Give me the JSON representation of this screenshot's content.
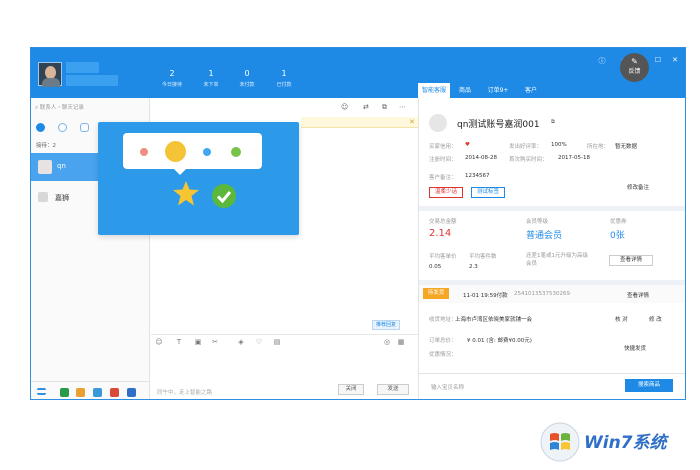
{
  "stats": [
    {
      "num": "2",
      "label": "今日接待"
    },
    {
      "num": "1",
      "label": "未下单"
    },
    {
      "num": "0",
      "label": "未付款"
    },
    {
      "num": "1",
      "label": "已付款"
    }
  ],
  "right_tabs": [
    "智能客服",
    "商品",
    "订单9+",
    "客户"
  ],
  "left_panel": {
    "search_placeholder": "联系人・聊天记录",
    "queue_label": "接待：2",
    "contacts": [
      {
        "name": "qn",
        "selected": true
      },
      {
        "name": "嘉狮",
        "selected": false
      }
    ]
  },
  "chat": {
    "recommend_label": "推荐回复",
    "input_hint": "同午中，走上智能之路",
    "close_btn": "关闭",
    "send_btn": "发送"
  },
  "customer": {
    "account": "qn测试账号嘉润001",
    "credit_label": "买家信用：",
    "credit_value": "♥",
    "good_rate_label": "发出好评率：",
    "good_rate_value": "100%",
    "location_label": "所在地：",
    "location_value": "暂无数据",
    "reg_label": "注册时间：",
    "reg_value": "2014-08-28",
    "last_buy_label": "首次购买时间：",
    "last_buy_value": "2017-05-18",
    "remark_label": "客户备注：",
    "remark_value": "1234567",
    "tag1": "温柔少话",
    "tag2": "测试标签",
    "modify_remark_btn": "修改备注"
  },
  "trade": {
    "total_label": "交易总金额",
    "total_value": "2.14",
    "level_label": "会员等级",
    "level_value": "普通会员",
    "coupon_label": "优惠券",
    "coupon_value": "0张",
    "avg_price_label": "平均客单价",
    "avg_price_value": "0.05",
    "avg_items_label": "平均客件数",
    "avg_items_value": "2.3",
    "gap_text": "还差1笔或1元升级为高级会员",
    "detail_btn": "查看详情"
  },
  "order": {
    "status_badge": "待发货",
    "time": "11-01 19:59付款",
    "order_no": "2541013537530269",
    "detail_btn": "查看详情",
    "addr_label": "收货地址：",
    "addr_value": "上海市卢湾区依晓美家就铺一会",
    "verify_btn": "核 对",
    "modify_btn": "修 改",
    "total_label": "订单总价：",
    "total_value": "¥ 0.01 (含: 邮费¥0.00元)",
    "discount_label": "优惠情况：",
    "ship_btn": "快捷发货"
  },
  "product_search": {
    "placeholder": "输入宝贝名称",
    "button": "搜索商品"
  },
  "feedback_label": "反馈",
  "colors": {
    "brand": "#1e8ae6",
    "popup": "#2c9ae8",
    "red": "#e0342f",
    "blue_value": "#1e8ae6"
  },
  "logo_text": "Win7系统"
}
